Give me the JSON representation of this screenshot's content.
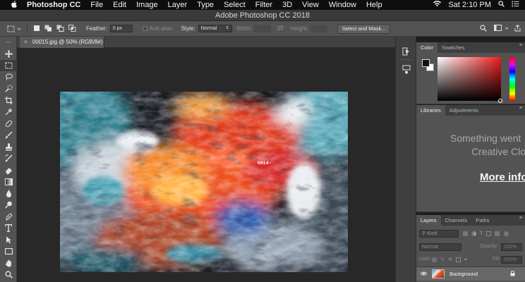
{
  "menubar": {
    "app_name": "Photoshop CC",
    "items": [
      "File",
      "Edit",
      "Image",
      "Layer",
      "Type",
      "Select",
      "Filter",
      "3D",
      "View",
      "Window",
      "Help"
    ],
    "clock": "Sat 2:10 PM"
  },
  "window": {
    "title": "Adobe Photoshop CC 2018"
  },
  "options": {
    "feather_label": "Feather:",
    "feather_value": "0 px",
    "antialias_label": "Anti-alias",
    "style_label": "Style:",
    "style_value": "Normal",
    "width_label": "Width:",
    "height_label": "Height:",
    "select_mask_label": "Select and Mask..."
  },
  "document": {
    "tab_title": "00015.jpg @ 50% (RGB/8#)",
    "image_label": "G014-"
  },
  "color_panel": {
    "tabs": [
      "Color",
      "Swatches"
    ],
    "foreground": "#111111",
    "background": "#ffffff"
  },
  "libraries_panel": {
    "tabs": [
      "Libraries",
      "Adjustments"
    ],
    "message_line1": "Something went",
    "message_line2": "Creative Clo",
    "more_info": "More info"
  },
  "layers_panel": {
    "tabs": [
      "Layers",
      "Channels",
      "Paths"
    ],
    "kind_label": "Kind",
    "blend_mode": "Normal",
    "opacity_label": "Opacity:",
    "opacity_value": "100%",
    "lock_label": "Lock:",
    "fill_label": "Fill:",
    "fill_value": "100%",
    "layers": [
      {
        "name": "Background",
        "visible": true,
        "locked": true
      }
    ]
  },
  "colors": {
    "accent": "#3b6dd7",
    "panel_bg": "#535353",
    "canvas_bg": "#282828"
  }
}
